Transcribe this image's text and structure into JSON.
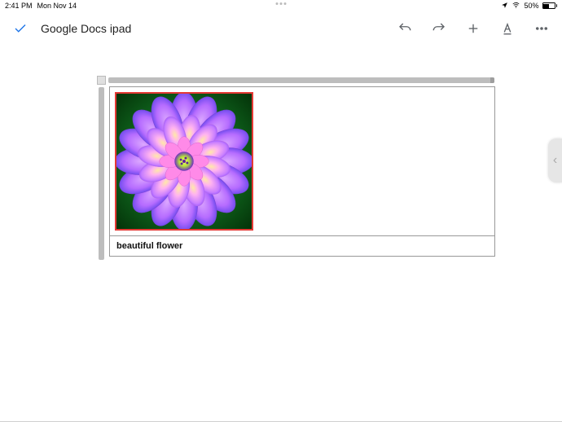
{
  "status": {
    "time": "2:41 PM",
    "date": "Mon Nov 14",
    "battery": "50%"
  },
  "toolbar": {
    "title": "Google Docs ipad"
  },
  "doc": {
    "caption": "beautiful flower"
  }
}
